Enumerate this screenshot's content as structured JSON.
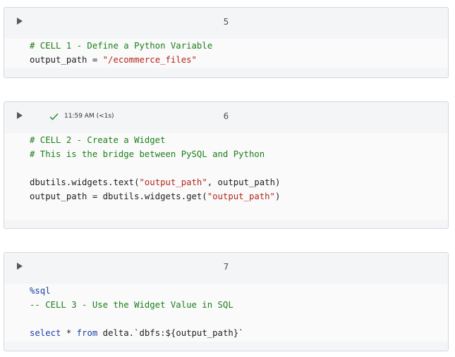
{
  "cells": [
    {
      "number": "5",
      "status": null,
      "lines": [
        [
          {
            "cls": "c-comment",
            "text": "# CELL 1 - Define a Python Variable"
          }
        ],
        [
          {
            "cls": "c-plain",
            "text": "output_path = "
          },
          {
            "cls": "c-str",
            "text": "\"/ecommerce_files\""
          }
        ]
      ]
    },
    {
      "number": "6",
      "status": {
        "icon": "check-icon",
        "text": "11:59 AM (<1s)",
        "color": "#2e8b3d"
      },
      "lines": [
        [
          {
            "cls": "c-comment",
            "text": "# CELL 2 - Create a Widget"
          }
        ],
        [
          {
            "cls": "c-comment",
            "text": "# This is the bridge between PySQL and Python"
          }
        ],
        [],
        [
          {
            "cls": "c-plain",
            "text": "dbutils.widgets.text("
          },
          {
            "cls": "c-str",
            "text": "\"output_path\""
          },
          {
            "cls": "c-plain",
            "text": ", output_path)"
          }
        ],
        [
          {
            "cls": "c-plain",
            "text": "output_path = dbutils.widgets.get("
          },
          {
            "cls": "c-str",
            "text": "\"output_path\""
          },
          {
            "cls": "c-plain",
            "text": ")"
          }
        ]
      ]
    },
    {
      "number": "7",
      "status": null,
      "lines": [
        [
          {
            "cls": "c-kw",
            "text": "%sql"
          }
        ],
        [
          {
            "cls": "c-comment",
            "text": "-- CELL 3 - Use the Widget Value in SQL"
          }
        ],
        [],
        [
          {
            "cls": "c-kw",
            "text": "select"
          },
          {
            "cls": "c-plain",
            "text": " * "
          },
          {
            "cls": "c-kw",
            "text": "from"
          },
          {
            "cls": "c-plain",
            "text": " delta.`dbfs:${output_path}`"
          }
        ]
      ]
    }
  ],
  "colors": {
    "cell_bg": "#f4f5f7",
    "code_bg": "#fafafa",
    "border": "#d3d8de",
    "comment": "#1a7f1a",
    "string": "#b3261e",
    "keyword": "#1c3fa8",
    "run_icon": "#55595e",
    "check": "#2e8b3d"
  }
}
